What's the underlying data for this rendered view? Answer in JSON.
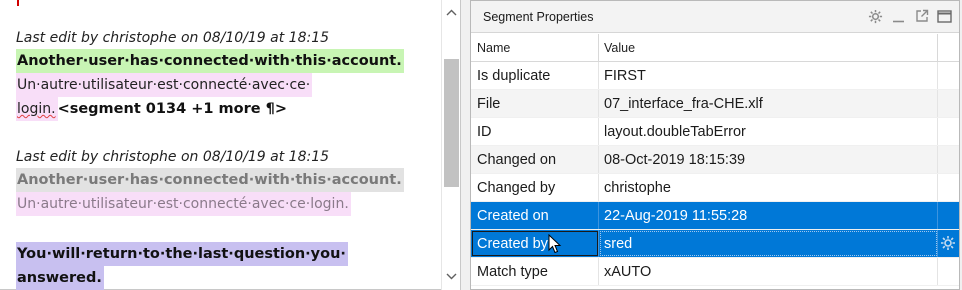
{
  "editor": {
    "segment1": {
      "meta": "Last edit by christophe on 08/10/19 at 18:15",
      "source": "Another·user·has·connected·with·this·account.",
      "target_line1": "Un·autre·utilisateur·est·connecté·avec·ce·",
      "target_line2_text": "login.",
      "target_line2_tag": "<segment 0134 +1 more ¶>"
    },
    "segment2": {
      "meta": "Last edit by christophe on 08/10/19 at 18:15",
      "source": "Another·user·has·connected·with·this·account.",
      "target": "Un·autre·utilisateur·est·connecté·avec·ce·login."
    },
    "segment3": {
      "source_line1": "You·will·return·to·the·last·question·you·",
      "source_line2": "answered."
    }
  },
  "panel": {
    "title": "Segment Properties",
    "columns": {
      "name": "Name",
      "value": "Value"
    },
    "rows": [
      {
        "name": "Is duplicate",
        "value": "FIRST"
      },
      {
        "name": "File",
        "value": "07_interface_fra-CHE.xlf"
      },
      {
        "name": "ID",
        "value": "layout.doubleTabError"
      },
      {
        "name": "Changed on",
        "value": "08-Oct-2019 18:15:39"
      },
      {
        "name": "Changed by",
        "value": "christophe"
      },
      {
        "name": "Created on",
        "value": "22-Aug-2019 11:55:28"
      },
      {
        "name": "Created by",
        "value": "sred"
      },
      {
        "name": "Match type",
        "value": "xAUTO"
      }
    ],
    "tools": [
      "gear-icon",
      "minimize-icon",
      "popout-icon",
      "maximize-icon"
    ]
  },
  "colors": {
    "selection": "#0078d7",
    "source_confirmed": "#c8f5b4",
    "source_active": "#c8c0f0",
    "target_bg": "#f8def8"
  }
}
